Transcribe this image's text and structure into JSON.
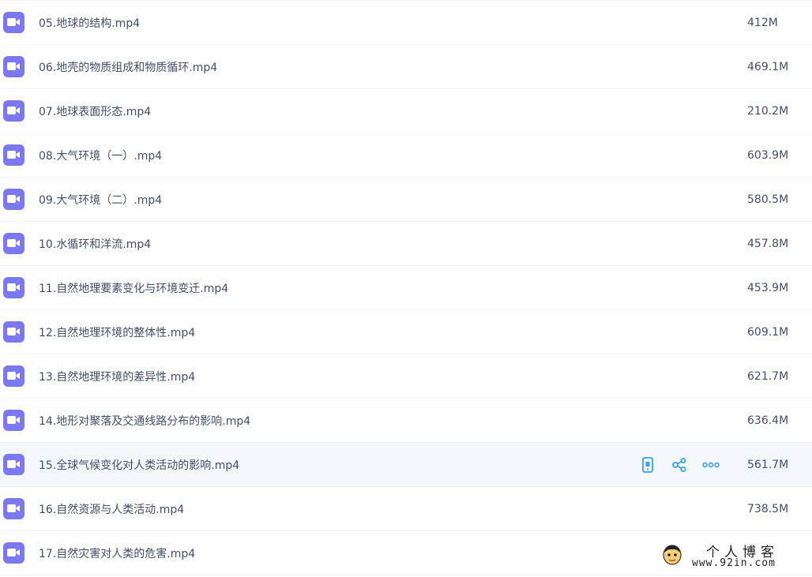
{
  "colors": {
    "video_icon": "#7c78f2",
    "text": "#424e67",
    "action_icon": "#3ba0e6",
    "hover_row": "#f2f8fc"
  },
  "files": [
    {
      "name": "05.地球的结构.mp4",
      "size": "412M"
    },
    {
      "name": "06.地壳的物质组成和物质循环.mp4",
      "size": "469.1M"
    },
    {
      "name": "07.地球表面形态.mp4",
      "size": "210.2M"
    },
    {
      "name": "08.大气环境（一）.mp4",
      "size": "603.9M"
    },
    {
      "name": "09.大气环境（二）.mp4",
      "size": "580.5M"
    },
    {
      "name": "10.水循环和洋流.mp4",
      "size": "457.8M"
    },
    {
      "name": "11.自然地理要素变化与环境变迁.mp4",
      "size": "453.9M"
    },
    {
      "name": "12.自然地理环境的整体性.mp4",
      "size": "609.1M"
    },
    {
      "name": "13.自然地理环境的差异性.mp4",
      "size": "621.7M"
    },
    {
      "name": "14.地形对聚落及交通线路分布的影响.mp4",
      "size": "636.4M"
    },
    {
      "name": "15.全球气候变化对人类活动的影响.mp4",
      "size": "561.7M",
      "hovered": true
    },
    {
      "name": "16.自然资源与人类活动.mp4",
      "size": "738.5M"
    },
    {
      "name": "17.自然灾害对人类的危害.mp4",
      "size": ""
    }
  ],
  "row_actions": {
    "icons": [
      "phone-icon",
      "share-icon",
      "more-icon"
    ]
  },
  "watermark": {
    "title": "个人博客",
    "url": "www.92in.com"
  }
}
